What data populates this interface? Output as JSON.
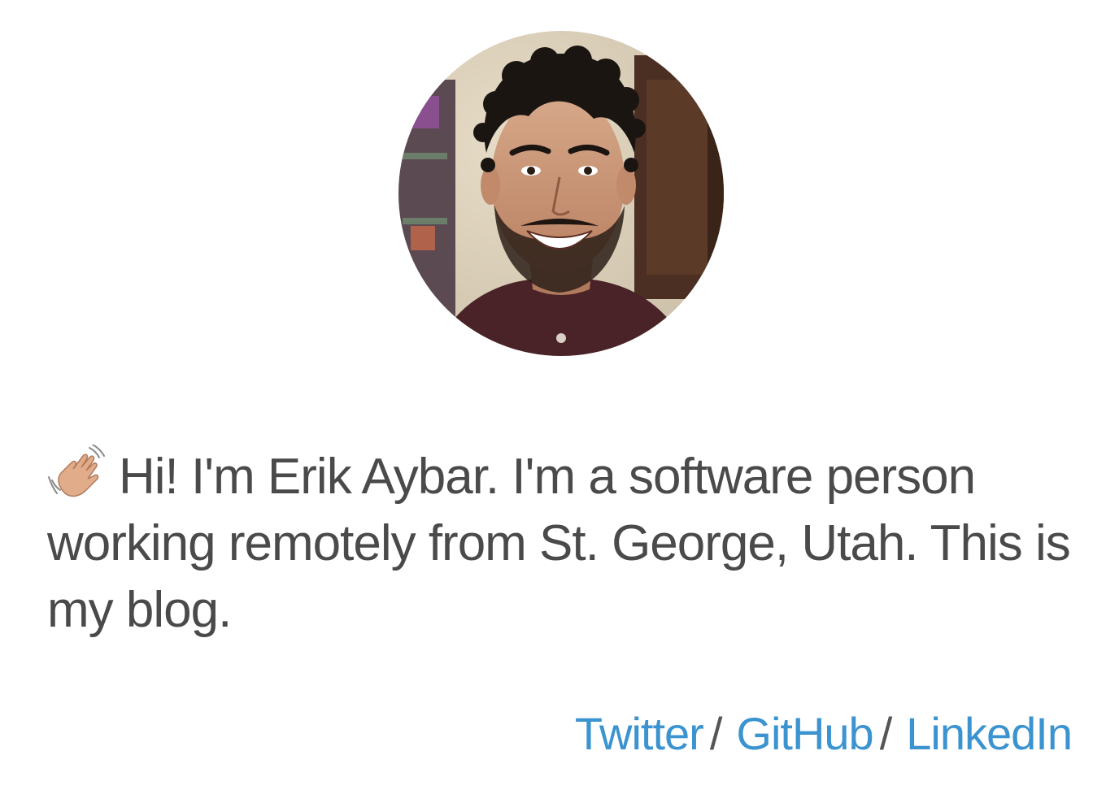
{
  "profile": {
    "photo_alt": "Erik Aybar",
    "intro": "Hi! I'm Erik Aybar. I'm a software person working remotely from St. George, Utah. This is my blog.",
    "intro_icon": "waving-hand-icon"
  },
  "social": {
    "links": [
      {
        "label": "Twitter"
      },
      {
        "label": "GitHub"
      },
      {
        "label": "LinkedIn"
      }
    ],
    "separator": "/"
  },
  "colors": {
    "link": "#3b93cf",
    "text": "#4a4a4a",
    "background": "#ffffff"
  }
}
